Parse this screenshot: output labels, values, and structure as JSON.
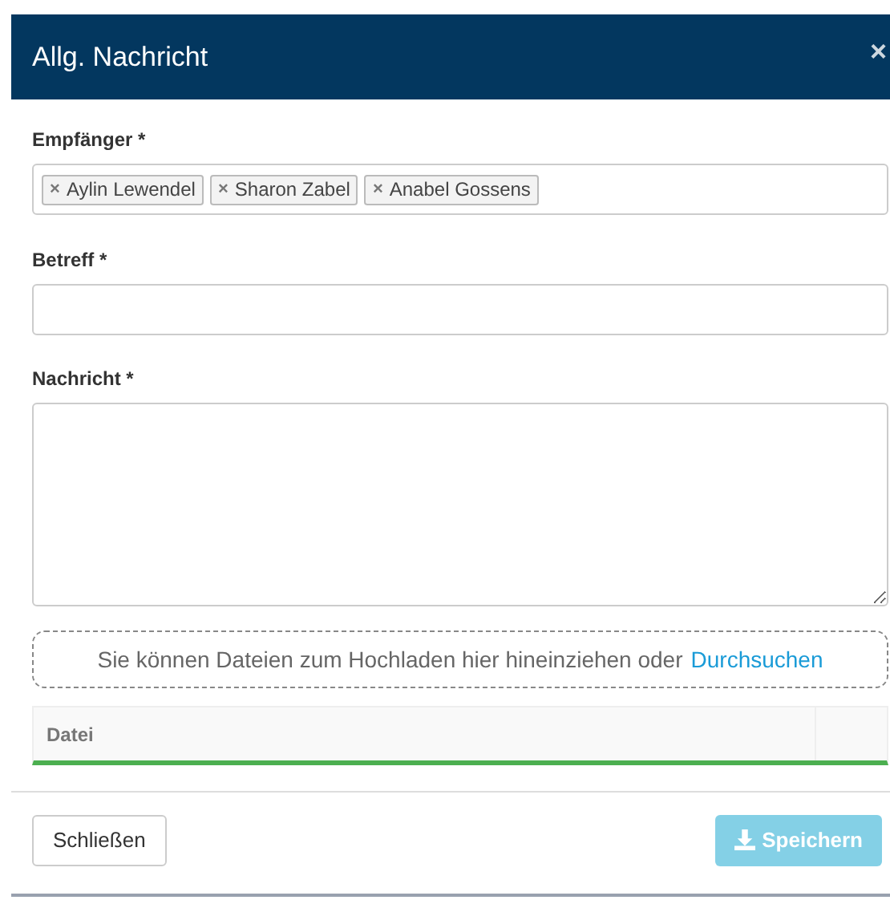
{
  "dialog": {
    "title": "Allg. Nachricht",
    "close": "×"
  },
  "recipients": {
    "label": "Empfänger *",
    "tags": [
      {
        "remove": "×",
        "name": "Aylin Lewendel"
      },
      {
        "remove": "×",
        "name": "Sharon Zabel"
      },
      {
        "remove": "×",
        "name": "Anabel Gossens"
      }
    ]
  },
  "subject": {
    "label": "Betreff *"
  },
  "message": {
    "label": "Nachricht *"
  },
  "dropzone": {
    "text": "Sie können Dateien zum Hochladen hier hineinziehen oder",
    "link": "Durchsuchen"
  },
  "files_table": {
    "columns": [
      "Datei"
    ]
  },
  "buttons": [
    {
      "kind": "secondary",
      "label": "Schließen",
      "disabled": false
    },
    {
      "kind": "primary",
      "label": "Speichern",
      "disabled": true
    }
  ]
}
